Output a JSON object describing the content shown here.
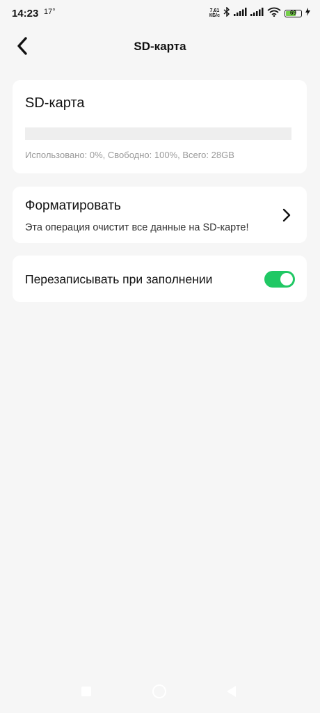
{
  "statusbar": {
    "time": "14:23",
    "temperature": "17°",
    "net_speed_value": "7,61",
    "net_speed_unit": "КБ/с",
    "battery": "69",
    "battery_level": 0.69
  },
  "header": {
    "title": "SD-карта",
    "back_icon": "chevron-left-icon"
  },
  "storage": {
    "title": "SD-карта",
    "used_fraction": 0.0,
    "info": "Использовано: 0%, Свободно: 100%, Всего: 28GB"
  },
  "format": {
    "title": "Форматировать",
    "description": "Эта операция очистит все данные на SD-карте!",
    "icon": "chevron-right-icon"
  },
  "overwrite": {
    "label": "Перезаписывать при заполнении",
    "enabled": true
  },
  "colors": {
    "accent": "#20c864",
    "background": "#f6f6f6",
    "card": "#ffffff",
    "battery_fill": "#76d04a"
  }
}
